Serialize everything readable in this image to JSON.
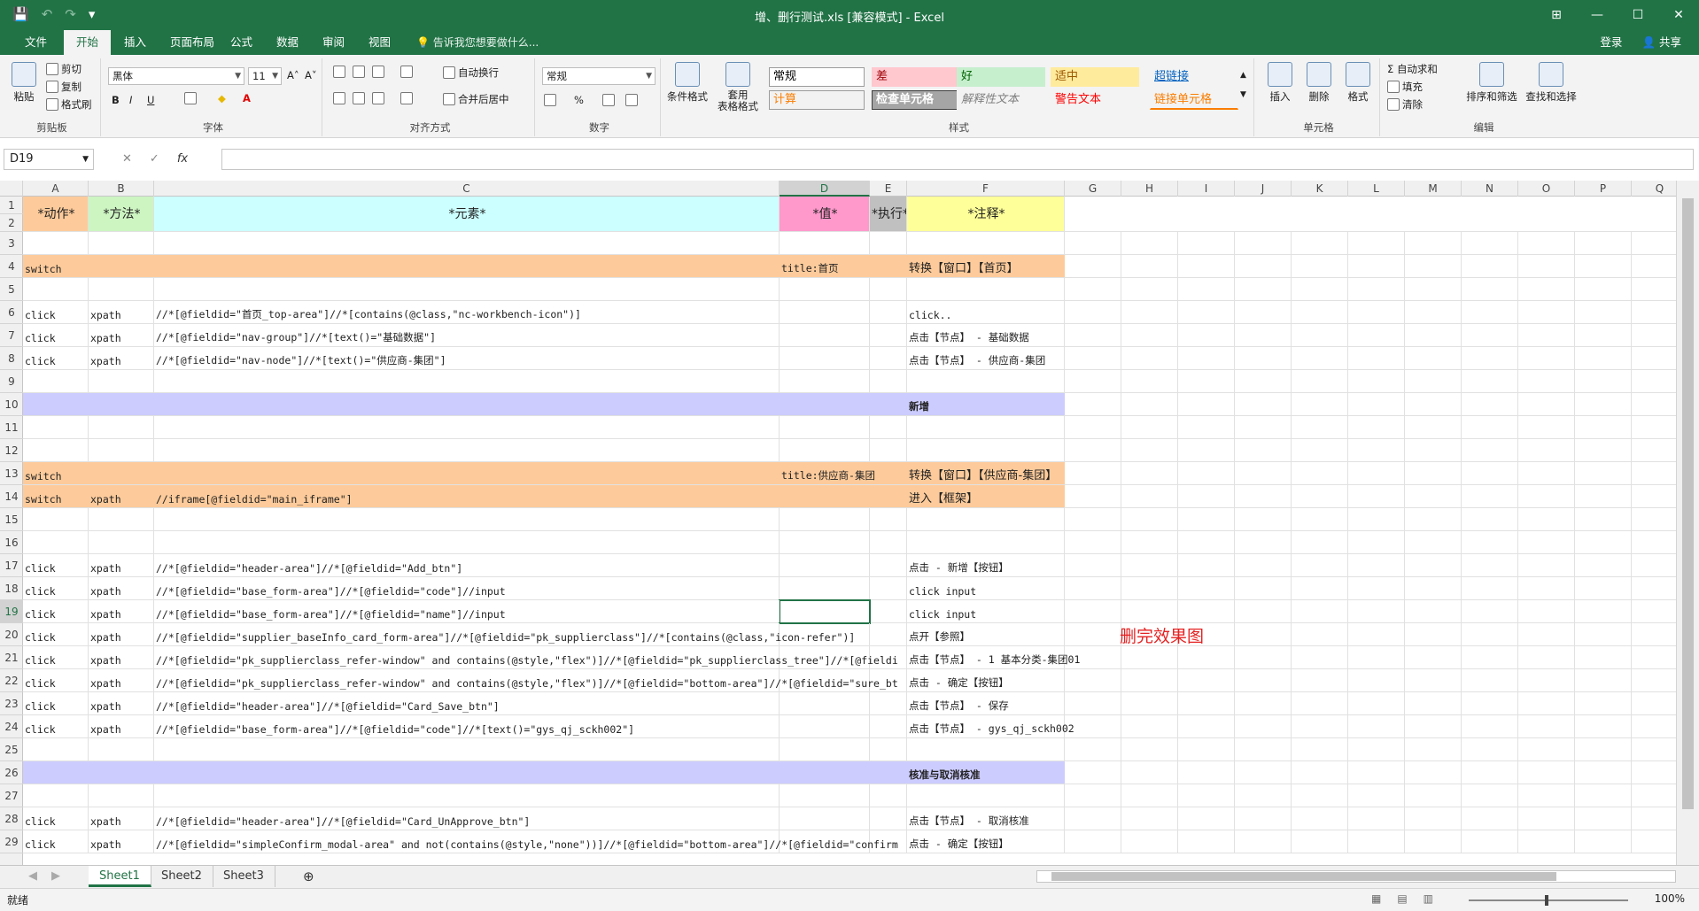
{
  "window": {
    "title": "增、删行测试.xls  [兼容模式] - Excel",
    "qat": [
      "💾",
      "↶",
      "↷",
      "▾"
    ],
    "controls": [
      "⊞",
      "—",
      "☐",
      "✕"
    ]
  },
  "tabs": [
    "文件",
    "开始",
    "插入",
    "页面布局",
    "公式",
    "数据",
    "审阅",
    "视图"
  ],
  "tell_me": "告诉我您想要做什么...",
  "account": {
    "login": "登录",
    "share": "共享"
  },
  "ribbon": {
    "clipboard": {
      "label": "剪贴板",
      "paste": "粘贴",
      "cut": "剪切",
      "copy": "复制",
      "format_painter": "格式刷"
    },
    "font": {
      "label": "字体",
      "name": "黑体",
      "size": "11",
      "bold": "B",
      "italic": "I",
      "underline": "U",
      "grow": "A˄",
      "shrink": "A˅"
    },
    "alignment": {
      "label": "对齐方式",
      "wrap": "自动换行",
      "merge": "合并后居中"
    },
    "number": {
      "label": "数字",
      "format": "常规",
      "percent": "%"
    },
    "styles": {
      "label": "样式",
      "conditional": "条件格式",
      "table": "套用\n表格格式",
      "cells": [
        {
          "text": "常规",
          "bg": "#ffffff",
          "fg": "#000000"
        },
        {
          "text": "差",
          "bg": "#ffc7ce",
          "fg": "#9c0006"
        },
        {
          "text": "好",
          "bg": "#c6efce",
          "fg": "#006100"
        },
        {
          "text": "适中",
          "bg": "#ffeb9c",
          "fg": "#9c5700"
        },
        {
          "text": "超链接",
          "bg": "#f3f3f3",
          "fg": "#0563c1"
        },
        {
          "text": "计算",
          "bg": "#f2f2f2",
          "fg": "#fa7d00"
        },
        {
          "text": "检查单元格",
          "bg": "#a5a5a5",
          "fg": "#ffffff"
        },
        {
          "text": "解释性文本",
          "bg": "#f3f3f3",
          "fg": "#7f7f7f"
        },
        {
          "text": "警告文本",
          "bg": "#f3f3f3",
          "fg": "#ff0000"
        },
        {
          "text": "链接单元格",
          "bg": "#f3f3f3",
          "fg": "#fa7d00"
        }
      ]
    },
    "cells": {
      "label": "单元格",
      "insert": "插入",
      "delete": "删除",
      "format": "格式"
    },
    "editing": {
      "label": "编辑",
      "autosum": "自动求和",
      "fill": "填充",
      "clear": "清除",
      "sort": "排序和筛选",
      "find": "查找和选择"
    }
  },
  "formula_bar": {
    "name_box": "D19",
    "cancel": "✕",
    "enter": "✓",
    "fx": "fx",
    "content": ""
  },
  "columns": [
    "A",
    "B",
    "C",
    "D",
    "E",
    "F",
    "G",
    "H",
    "I",
    "J",
    "K",
    "L",
    "M",
    "N",
    "O",
    "P",
    "Q"
  ],
  "selected_column": "D",
  "selected_row": "19",
  "colors": {
    "orange": "#fdcb9b",
    "purple": "#ccccff",
    "green_hdr": "#cdf5c2",
    "cyan_hdr": "#ccffff",
    "pink_hdr": "#ff99cc",
    "grey_hdr": "#c0c0c0",
    "yellow_hdr": "#ffff99",
    "accent": "#217346"
  },
  "header_row": {
    "a": "*动作*",
    "b": "*方法*",
    "c": "*元素*",
    "d": "*值*",
    "e": "*执行*",
    "f": "*注释*"
  },
  "rows": [
    {
      "n": "3",
      "fill": "",
      "a": "",
      "b": "",
      "c": "",
      "d": "",
      "f": ""
    },
    {
      "n": "4",
      "fill": "orange",
      "a": "switch",
      "b": "",
      "c": "",
      "d": "title:首页",
      "f": "转换【窗口】【首页】"
    },
    {
      "n": "5",
      "fill": "",
      "a": "",
      "b": "",
      "c": "",
      "d": "",
      "f": ""
    },
    {
      "n": "6",
      "fill": "",
      "a": "click",
      "b": "xpath",
      "c": "//*[@fieldid=\"首页_top-area\"]//*[contains(@class,\"nc-workbench-icon\")]",
      "d": "",
      "f": "click.."
    },
    {
      "n": "7",
      "fill": "",
      "a": "click",
      "b": "xpath",
      "c": "//*[@fieldid=\"nav-group\"]//*[text()=\"基础数据\"]",
      "d": "",
      "f": "点击【节点】 - 基础数据"
    },
    {
      "n": "8",
      "fill": "",
      "a": "click",
      "b": "xpath",
      "c": "//*[@fieldid=\"nav-node\"]//*[text()=\"供应商-集团\"]",
      "d": "",
      "f": "点击【节点】 - 供应商-集团"
    },
    {
      "n": "9",
      "fill": "",
      "a": "",
      "b": "",
      "c": "",
      "d": "",
      "f": ""
    },
    {
      "n": "10",
      "fill": "purple",
      "a": "",
      "b": "",
      "c": "",
      "d": "",
      "f": "新增"
    },
    {
      "n": "11",
      "fill": "",
      "a": "",
      "b": "",
      "c": "",
      "d": "",
      "f": ""
    },
    {
      "n": "12",
      "fill": "",
      "a": "",
      "b": "",
      "c": "",
      "d": "",
      "f": ""
    },
    {
      "n": "13",
      "fill": "orange",
      "a": "switch",
      "b": "",
      "c": "",
      "d": "title:供应商-集团",
      "f": "转换【窗口】【供应商-集团】"
    },
    {
      "n": "14",
      "fill": "orange",
      "a": "switch",
      "b": "xpath",
      "c": "//iframe[@fieldid=\"main_iframe\"]",
      "d": "",
      "f": "进入【框架】"
    },
    {
      "n": "15",
      "fill": "",
      "a": "",
      "b": "",
      "c": "",
      "d": "",
      "f": ""
    },
    {
      "n": "16",
      "fill": "",
      "a": "",
      "b": "",
      "c": "",
      "d": "",
      "f": ""
    },
    {
      "n": "17",
      "fill": "",
      "a": "click",
      "b": "xpath",
      "c": "//*[@fieldid=\"header-area\"]//*[@fieldid=\"Add_btn\"]",
      "d": "",
      "f": "点击 - 新增【按钮】"
    },
    {
      "n": "18",
      "fill": "",
      "a": "click",
      "b": "xpath",
      "c": "//*[@fieldid=\"base_form-area\"]//*[@fieldid=\"code\"]//input",
      "d": "",
      "f": "click input"
    },
    {
      "n": "19",
      "fill": "",
      "a": "click",
      "b": "xpath",
      "c": "//*[@fieldid=\"base_form-area\"]//*[@fieldid=\"name\"]//input",
      "d": "",
      "f": "click input"
    },
    {
      "n": "20",
      "fill": "",
      "a": "click",
      "b": "xpath",
      "c": "//*[@fieldid=\"supplier_baseInfo_card_form-area\"]//*[@fieldid=\"pk_supplierclass\"]//*[contains(@class,\"icon-refer\")]",
      "d": "",
      "f": "点开【参照】"
    },
    {
      "n": "21",
      "fill": "",
      "a": "click",
      "b": "xpath",
      "c": "//*[@fieldid=\"pk_supplierclass_refer-window\" and contains(@style,\"flex\")]//*[@fieldid=\"pk_supplierclass_tree\"]//*[@fieldi",
      "d": "",
      "f": "点击【节点】 - 1 基本分类-集团01"
    },
    {
      "n": "22",
      "fill": "",
      "a": "click",
      "b": "xpath",
      "c": "//*[@fieldid=\"pk_supplierclass_refer-window\" and contains(@style,\"flex\")]//*[@fieldid=\"bottom-area\"]//*[@fieldid=\"sure_bt",
      "d": "",
      "f": "点击 - 确定【按钮】"
    },
    {
      "n": "23",
      "fill": "",
      "a": "click",
      "b": "xpath",
      "c": "//*[@fieldid=\"header-area\"]//*[@fieldid=\"Card_Save_btn\"]",
      "d": "",
      "f": "点击【节点】 - 保存"
    },
    {
      "n": "24",
      "fill": "",
      "a": "click",
      "b": "xpath",
      "c": "//*[@fieldid=\"base_form-area\"]//*[@fieldid=\"code\"]//*[text()=\"gys_qj_sckh002\"]",
      "d": "",
      "f": "点击【节点】 - gys_qj_sckh002"
    },
    {
      "n": "25",
      "fill": "",
      "a": "",
      "b": "",
      "c": "",
      "d": "",
      "f": ""
    },
    {
      "n": "26",
      "fill": "purple",
      "a": "",
      "b": "",
      "c": "",
      "d": "",
      "f": "核准与取消核准"
    },
    {
      "n": "27",
      "fill": "",
      "a": "",
      "b": "",
      "c": "",
      "d": "",
      "f": ""
    },
    {
      "n": "28",
      "fill": "",
      "a": "click",
      "b": "xpath",
      "c": "//*[@fieldid=\"header-area\"]//*[@fieldid=\"Card_UnApprove_btn\"]",
      "d": "",
      "f": "点击【节点】 - 取消核准"
    },
    {
      "n": "29",
      "fill": "",
      "a": "click",
      "b": "xpath",
      "c": "//*[@fieldid=\"simpleConfirm_modal-area\" and not(contains(@style,\"none\"))]//*[@fieldid=\"bottom-area\"]//*[@fieldid=\"confirm",
      "d": "",
      "f": "点击 - 确定【按钮】"
    }
  ],
  "annotation": "删完效果图",
  "sheets": [
    "Sheet1",
    "Sheet2",
    "Sheet3"
  ],
  "add_sheet": "⊕",
  "status": {
    "ready": "就绪",
    "zoom": "100%"
  }
}
